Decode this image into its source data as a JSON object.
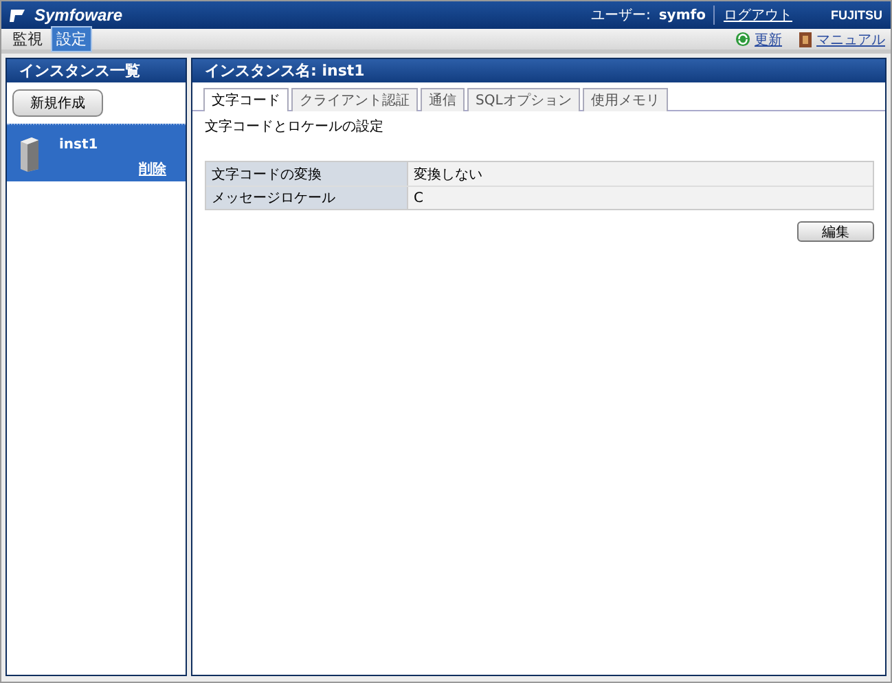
{
  "header": {
    "logo": "Symfoware",
    "user_label": "ユーザー:",
    "user_name": "symfo",
    "logout": "ログアウト",
    "brand": "FUJITSU"
  },
  "menu": {
    "items": [
      {
        "label": "監視",
        "selected": false
      },
      {
        "label": "設定",
        "selected": true
      }
    ],
    "actions": [
      {
        "kind": "refresh",
        "label": "更新"
      },
      {
        "kind": "manual",
        "label": "マニュアル"
      }
    ]
  },
  "sidebar": {
    "title": "インスタンス一覧",
    "new_button": "新規作成",
    "instances": [
      {
        "name": "inst1",
        "delete": "削除",
        "selected": true
      }
    ]
  },
  "main": {
    "title": "インスタンス名: inst1",
    "tabs": [
      {
        "label": "文字コード",
        "selected": true
      },
      {
        "label": "クライアント認証",
        "selected": false
      },
      {
        "label": "通信",
        "selected": false
      },
      {
        "label": "SQLオプション",
        "selected": false
      },
      {
        "label": "使用メモリ",
        "selected": false
      }
    ],
    "section": "文字コードとロケールの設定",
    "rows": [
      {
        "label": "文字コードの変換",
        "value": "変換しない"
      },
      {
        "label": "メッセージロケール",
        "value": "C"
      }
    ],
    "edit_button": "編集"
  }
}
